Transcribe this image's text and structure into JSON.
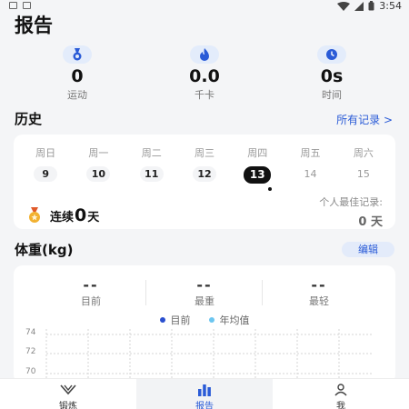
{
  "status_bar": {
    "time": "3:54"
  },
  "page_title": "报告",
  "stats": [
    {
      "value": "0",
      "label": "运动",
      "icon": "medal-icon"
    },
    {
      "value": "0.0",
      "label": "千卡",
      "icon": "flame-icon"
    },
    {
      "value": "0s",
      "label": "时间",
      "icon": "clock-icon"
    }
  ],
  "history": {
    "title": "历史",
    "all_records": "所有记录 >",
    "days": [
      {
        "name": "周日",
        "date": "9",
        "state": "past"
      },
      {
        "name": "周一",
        "date": "10",
        "state": "past"
      },
      {
        "name": "周二",
        "date": "11",
        "state": "past"
      },
      {
        "name": "周三",
        "date": "12",
        "state": "past"
      },
      {
        "name": "周四",
        "date": "13",
        "state": "today"
      },
      {
        "name": "周五",
        "date": "14",
        "state": "future"
      },
      {
        "name": "周六",
        "date": "15",
        "state": "future"
      }
    ],
    "streak_prefix": "连续",
    "streak_value": "0",
    "streak_suffix": "天",
    "best_label": "个人最佳记录:",
    "best_value": "0 天"
  },
  "weight": {
    "title": "体重(kg)",
    "edit": "编辑",
    "stats": [
      {
        "value": "--",
        "label": "目前"
      },
      {
        "value": "--",
        "label": "最重"
      },
      {
        "value": "--",
        "label": "最轻"
      }
    ],
    "legend": [
      {
        "label": "目前",
        "color": "#2a4fcf"
      },
      {
        "label": "年均值",
        "color": "#6cc6f0"
      }
    ],
    "y_ticks": [
      "74",
      "72",
      "70"
    ]
  },
  "tabs": [
    {
      "label": "锻炼",
      "icon": "workout-icon",
      "active": false
    },
    {
      "label": "报告",
      "icon": "bar-chart-icon",
      "active": true
    },
    {
      "label": "我",
      "icon": "person-icon",
      "active": false
    }
  ],
  "colors": {
    "accent": "#2a5bd7",
    "background": "#f4f5f7",
    "card": "#ffffff"
  }
}
